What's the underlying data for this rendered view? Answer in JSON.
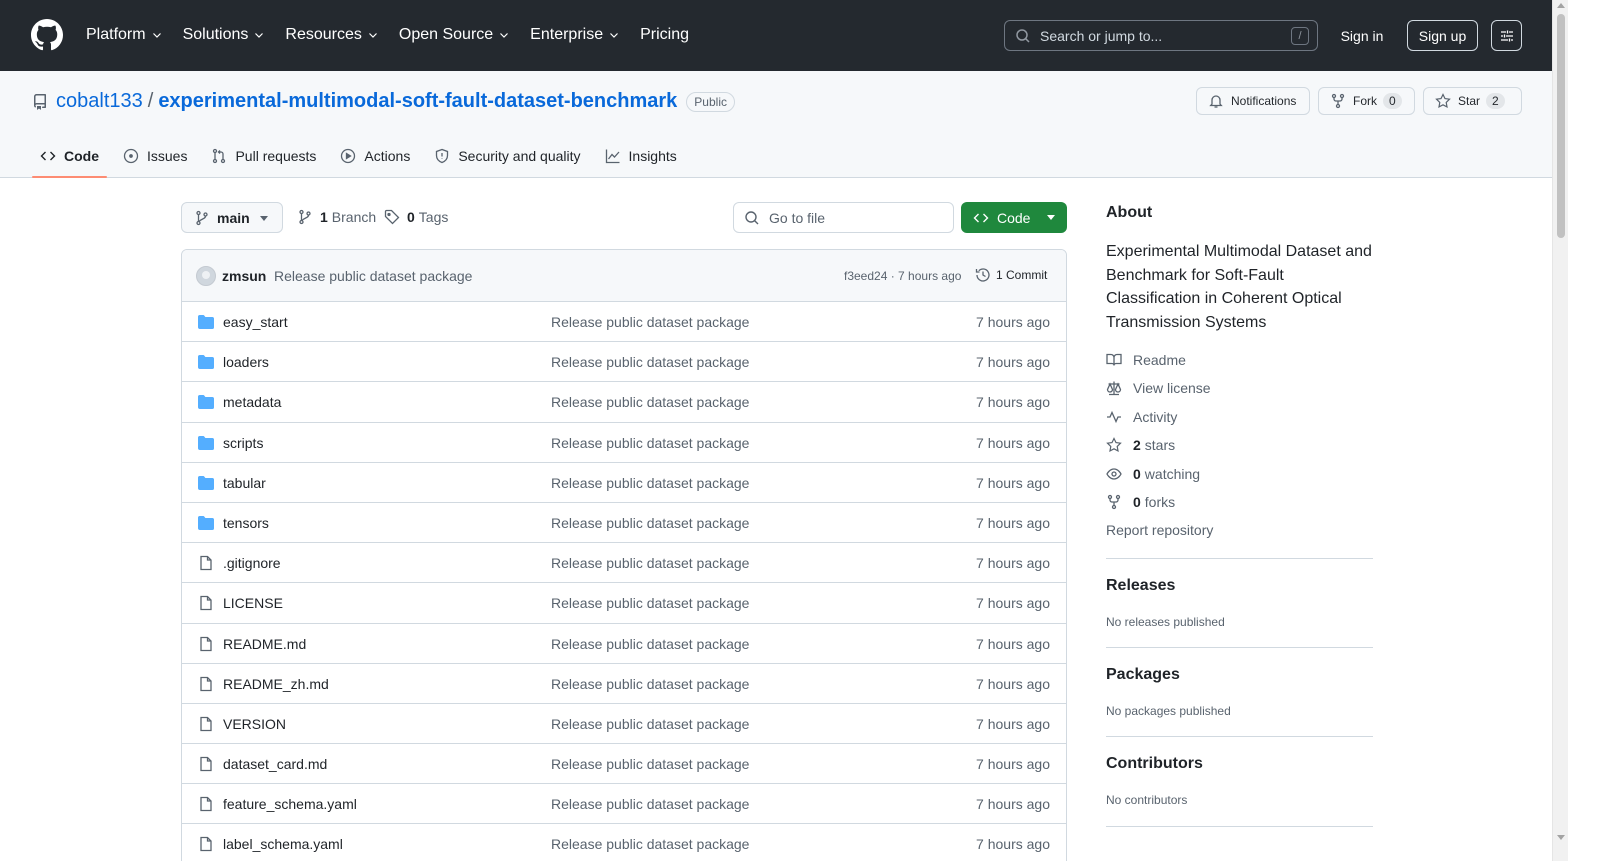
{
  "header": {
    "nav": [
      {
        "label": "Platform",
        "has_menu": true
      },
      {
        "label": "Solutions",
        "has_menu": true
      },
      {
        "label": "Resources",
        "has_menu": true
      },
      {
        "label": "Open Source",
        "has_menu": true
      },
      {
        "label": "Enterprise",
        "has_menu": true
      },
      {
        "label": "Pricing",
        "has_menu": false
      }
    ],
    "search_placeholder": "Search or jump to...",
    "search_shortcut": "/",
    "sign_in": "Sign in",
    "sign_up": "Sign up"
  },
  "repo": {
    "owner": "cobalt133",
    "separator": "/",
    "name": "experimental-multimodal-soft-fault-dataset-benchmark",
    "visibility": "Public",
    "notifications_label": "Notifications",
    "fork_label": "Fork",
    "fork_count": "0",
    "star_label": "Star",
    "star_count": "2"
  },
  "tabs": [
    {
      "label": "Code",
      "icon": "code-icon",
      "active": true
    },
    {
      "label": "Issues",
      "icon": "issue-icon",
      "active": false
    },
    {
      "label": "Pull requests",
      "icon": "pull-request-icon",
      "active": false
    },
    {
      "label": "Actions",
      "icon": "play-icon",
      "active": false
    },
    {
      "label": "Security and quality",
      "icon": "shield-icon",
      "active": false
    },
    {
      "label": "Insights",
      "icon": "graph-icon",
      "active": false
    }
  ],
  "toolbar": {
    "branch": "main",
    "branch_count": "1",
    "branch_label": "Branch",
    "tag_count": "0",
    "tag_label": "Tags",
    "goto_file_placeholder": "Go to file",
    "code_button": "Code"
  },
  "latest_commit": {
    "author": "zmsun",
    "message": "Release public dataset package",
    "sha_time": "f3eed24 · 7 hours ago",
    "commit_count": "1 Commit"
  },
  "files": [
    {
      "name": "easy_start",
      "type": "dir",
      "message": "Release public dataset package",
      "time": "7 hours ago"
    },
    {
      "name": "loaders",
      "type": "dir",
      "message": "Release public dataset package",
      "time": "7 hours ago"
    },
    {
      "name": "metadata",
      "type": "dir",
      "message": "Release public dataset package",
      "time": "7 hours ago"
    },
    {
      "name": "scripts",
      "type": "dir",
      "message": "Release public dataset package",
      "time": "7 hours ago"
    },
    {
      "name": "tabular",
      "type": "dir",
      "message": "Release public dataset package",
      "time": "7 hours ago"
    },
    {
      "name": "tensors",
      "type": "dir",
      "message": "Release public dataset package",
      "time": "7 hours ago"
    },
    {
      "name": ".gitignore",
      "type": "file",
      "message": "Release public dataset package",
      "time": "7 hours ago"
    },
    {
      "name": "LICENSE",
      "type": "file",
      "message": "Release public dataset package",
      "time": "7 hours ago"
    },
    {
      "name": "README.md",
      "type": "file",
      "message": "Release public dataset package",
      "time": "7 hours ago"
    },
    {
      "name": "README_zh.md",
      "type": "file",
      "message": "Release public dataset package",
      "time": "7 hours ago"
    },
    {
      "name": "VERSION",
      "type": "file",
      "message": "Release public dataset package",
      "time": "7 hours ago"
    },
    {
      "name": "dataset_card.md",
      "type": "file",
      "message": "Release public dataset package",
      "time": "7 hours ago"
    },
    {
      "name": "feature_schema.yaml",
      "type": "file",
      "message": "Release public dataset package",
      "time": "7 hours ago"
    },
    {
      "name": "label_schema.yaml",
      "type": "file",
      "message": "Release public dataset package",
      "time": "7 hours ago"
    }
  ],
  "about": {
    "title": "About",
    "description": "Experimental Multimodal Dataset and Benchmark for Soft-Fault Classification in Coherent Optical Transmission Systems",
    "readme": "Readme",
    "license": "View license",
    "activity": "Activity",
    "stars_count": "2",
    "stars_label": "stars",
    "watching_count": "0",
    "watching_label": "watching",
    "forks_count": "0",
    "forks_label": "forks",
    "report": "Report repository"
  },
  "releases": {
    "title": "Releases",
    "note": "No releases published"
  },
  "packages": {
    "title": "Packages",
    "note": "No packages published"
  },
  "contributors": {
    "title": "Contributors",
    "note": "No contributors"
  },
  "colors": {
    "header_bg": "#24292f",
    "link": "#0969da",
    "primary_button": "#1f883d",
    "active_tab_underline": "#fd8c73",
    "folder": "#54aeff"
  }
}
